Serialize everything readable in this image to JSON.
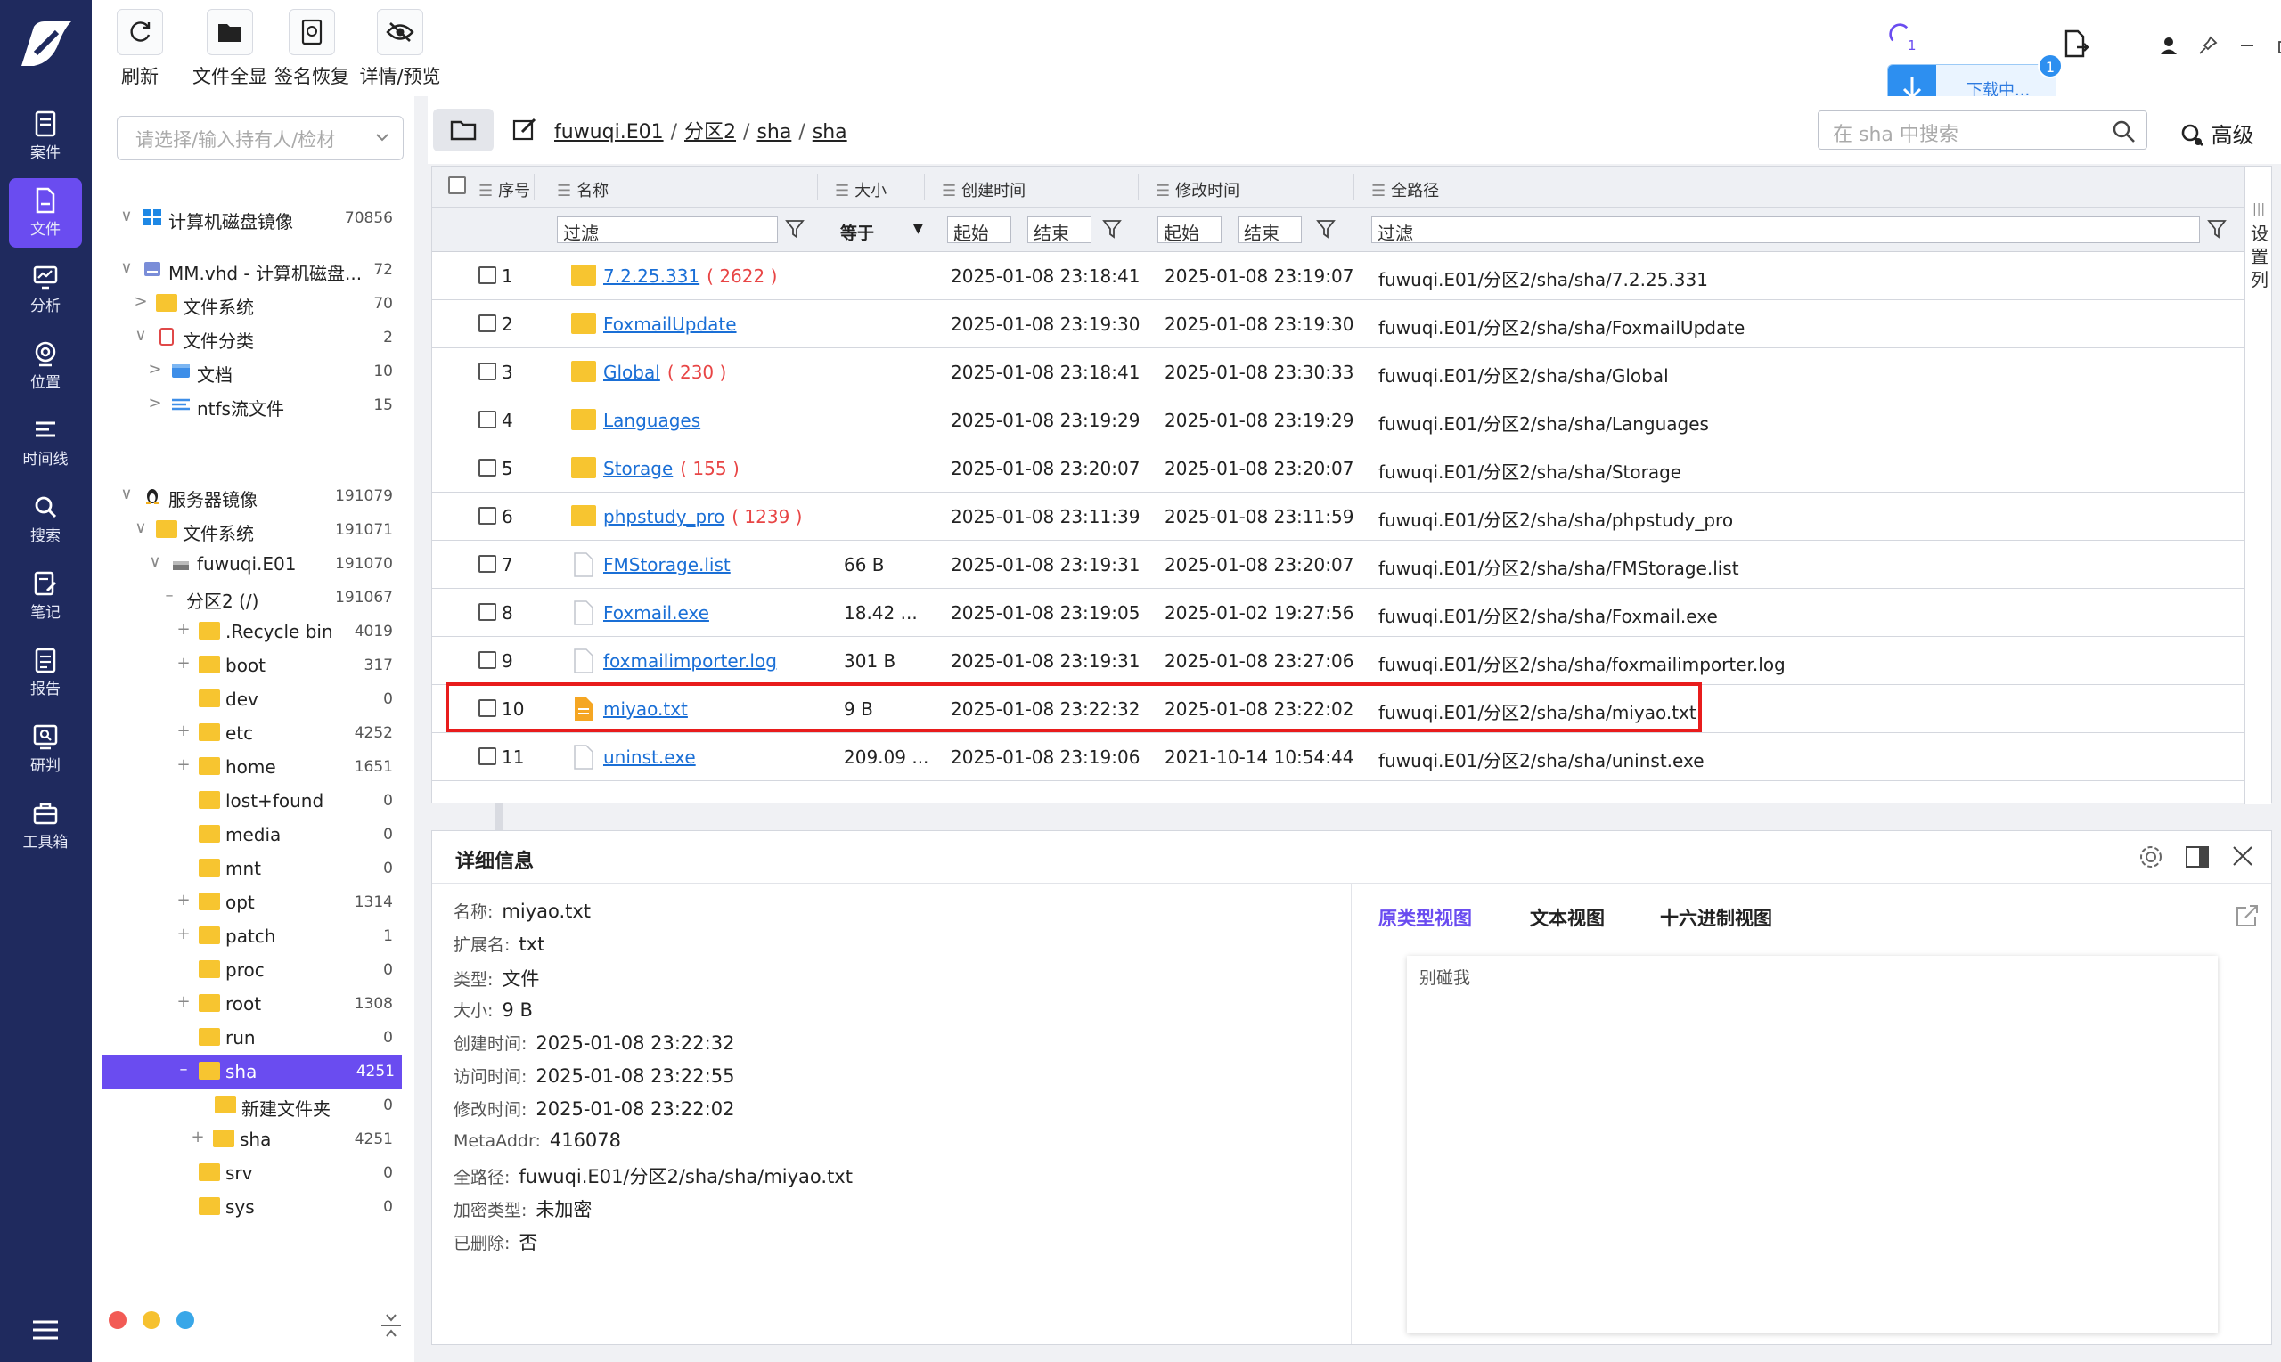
{
  "nav": {
    "items": [
      {
        "id": "case",
        "label": "案件"
      },
      {
        "id": "file",
        "label": "文件"
      },
      {
        "id": "analysis",
        "label": "分析"
      },
      {
        "id": "location",
        "label": "位置"
      },
      {
        "id": "timeline",
        "label": "时间线"
      },
      {
        "id": "search",
        "label": "搜索"
      },
      {
        "id": "notes",
        "label": "笔记"
      },
      {
        "id": "report",
        "label": "报告"
      },
      {
        "id": "judge",
        "label": "研判"
      },
      {
        "id": "toolbox",
        "label": "工具箱"
      }
    ],
    "active": "file"
  },
  "toolbar": {
    "refresh_label": "刷新",
    "show_all_label": "文件全显",
    "sig_restore_label": "签名恢复",
    "details_preview_label": "详情/预览",
    "progress_text": "1",
    "download_text": "下载中...",
    "download_badge": "1"
  },
  "tree": {
    "search_placeholder": "请选择/输入持有人/检材",
    "nodes": [
      {
        "label": "计算机磁盘镜像",
        "count": "70856"
      },
      {
        "label": "MM.vhd - 计算机磁盘...",
        "count": "72"
      },
      {
        "label": "文件系统",
        "count": "70"
      },
      {
        "label": "文件分类",
        "count": "2"
      },
      {
        "label": "文档",
        "count": "10"
      },
      {
        "label": "ntfs流文件",
        "count": "15"
      },
      {
        "label": "服务器镜像",
        "count": "191079"
      },
      {
        "label": "文件系统",
        "count": "191071"
      },
      {
        "label": "fuwuqi.E01",
        "count": "191070"
      },
      {
        "label": "分区2 (/)",
        "count": "191067"
      },
      {
        "label": ".Recycle bin",
        "count": "4019"
      },
      {
        "label": "boot",
        "count": "317"
      },
      {
        "label": "dev",
        "count": "0"
      },
      {
        "label": "etc",
        "count": "4252"
      },
      {
        "label": "home",
        "count": "1651"
      },
      {
        "label": "lost+found",
        "count": "0"
      },
      {
        "label": "media",
        "count": "0"
      },
      {
        "label": "mnt",
        "count": "0"
      },
      {
        "label": "opt",
        "count": "1314"
      },
      {
        "label": "patch",
        "count": "1"
      },
      {
        "label": "proc",
        "count": "0"
      },
      {
        "label": "root",
        "count": "1308"
      },
      {
        "label": "run",
        "count": "0"
      },
      {
        "label": "sha",
        "count": "4251"
      },
      {
        "label": "新建文件夹",
        "count": "0"
      },
      {
        "label": "sha",
        "count": "4251"
      },
      {
        "label": "srv",
        "count": "0"
      },
      {
        "label": "sys",
        "count": "0"
      }
    ]
  },
  "path": {
    "crumbs": [
      "fuwuqi.E01",
      "分区2",
      "sha",
      "sha"
    ],
    "search_placeholder": "在 sha 中搜索",
    "advanced_label": "高级"
  },
  "table": {
    "headers": {
      "index": "序号",
      "name": "名称",
      "size": "大小",
      "created": "创建时间",
      "modified": "修改时间",
      "fullpath": "全路径"
    },
    "filter": {
      "name_placeholder": "过滤",
      "size_op": "等于",
      "start": "起始",
      "end": "结束",
      "path_placeholder": "过滤"
    },
    "column_settings_label": "设置列",
    "rows": [
      {
        "index": "1",
        "name": "7.2.25.331",
        "count": "( 2622 )",
        "size": "",
        "created": "2025-01-08 23:18:41",
        "modified": "2025-01-08 23:19:07",
        "path": "fuwuqi.E01/分区2/sha/sha/7.2.25.331",
        "type": "folder"
      },
      {
        "index": "2",
        "name": "FoxmailUpdate",
        "count": "",
        "size": "",
        "created": "2025-01-08 23:19:30",
        "modified": "2025-01-08 23:19:30",
        "path": "fuwuqi.E01/分区2/sha/sha/FoxmailUpdate",
        "type": "folder"
      },
      {
        "index": "3",
        "name": "Global",
        "count": "( 230 )",
        "size": "",
        "created": "2025-01-08 23:18:41",
        "modified": "2025-01-08 23:30:33",
        "path": "fuwuqi.E01/分区2/sha/sha/Global",
        "type": "folder"
      },
      {
        "index": "4",
        "name": "Languages",
        "count": "",
        "size": "",
        "created": "2025-01-08 23:19:29",
        "modified": "2025-01-08 23:19:29",
        "path": "fuwuqi.E01/分区2/sha/sha/Languages",
        "type": "folder"
      },
      {
        "index": "5",
        "name": "Storage",
        "count": "( 155 )",
        "size": "",
        "created": "2025-01-08 23:20:07",
        "modified": "2025-01-08 23:20:07",
        "path": "fuwuqi.E01/分区2/sha/sha/Storage",
        "type": "folder"
      },
      {
        "index": "6",
        "name": "phpstudy_pro",
        "count": "( 1239 )",
        "size": "",
        "created": "2025-01-08 23:11:39",
        "modified": "2025-01-08 23:11:59",
        "path": "fuwuqi.E01/分区2/sha/sha/phpstudy_pro",
        "type": "folder"
      },
      {
        "index": "7",
        "name": "FMStorage.list",
        "count": "",
        "size": "66 B",
        "created": "2025-01-08 23:19:31",
        "modified": "2025-01-08 23:20:07",
        "path": "fuwuqi.E01/分区2/sha/sha/FMStorage.list",
        "type": "file"
      },
      {
        "index": "8",
        "name": "Foxmail.exe",
        "count": "",
        "size": "18.42 ...",
        "created": "2025-01-08 23:19:05",
        "modified": "2025-01-02 19:27:56",
        "path": "fuwuqi.E01/分区2/sha/sha/Foxmail.exe",
        "type": "file"
      },
      {
        "index": "9",
        "name": "foxmailimporter.log",
        "count": "",
        "size": "301 B",
        "created": "2025-01-08 23:19:31",
        "modified": "2025-01-08 23:27:06",
        "path": "fuwuqi.E01/分区2/sha/sha/foxmailimporter.log",
        "type": "file"
      },
      {
        "index": "10",
        "name": "miyao.txt",
        "count": "",
        "size": "9 B",
        "created": "2025-01-08 23:22:32",
        "modified": "2025-01-08 23:22:02",
        "path": "fuwuqi.E01/分区2/sha/sha/miyao.txt",
        "type": "txt"
      },
      {
        "index": "11",
        "name": "uninst.exe",
        "count": "",
        "size": "209.09 ...",
        "created": "2025-01-08 23:19:06",
        "modified": "2021-10-14 10:54:44",
        "path": "fuwuqi.E01/分区2/sha/sha/uninst.exe",
        "type": "file"
      }
    ]
  },
  "details": {
    "title": "详细信息",
    "fields": [
      {
        "k": "名称:",
        "v": "miyao.txt"
      },
      {
        "k": "扩展名:",
        "v": "txt"
      },
      {
        "k": "类型:",
        "v": "文件"
      },
      {
        "k": "大小:",
        "v": "9 B"
      },
      {
        "k": "创建时间:",
        "v": "2025-01-08 23:22:32"
      },
      {
        "k": "访问时间:",
        "v": "2025-01-08 23:22:55"
      },
      {
        "k": "修改时间:",
        "v": "2025-01-08 23:22:02"
      },
      {
        "k": "MetaAddr:",
        "v": "416078"
      },
      {
        "k": "全路径:",
        "v": "fuwuqi.E01/分区2/sha/sha/miyao.txt"
      },
      {
        "k": "加密类型:",
        "v": "未加密"
      },
      {
        "k": "已删除:",
        "v": "否"
      }
    ],
    "tabs": [
      "原类型视图",
      "文本视图",
      "十六进制视图"
    ],
    "preview_text": "别碰我"
  },
  "colors": {
    "nav_bg": "#1f2a5e",
    "accent": "#6a4cf0",
    "link": "#1a6fd6",
    "highlight": "#e81c1c",
    "count_red": "#e84545",
    "folder": "#f7c530"
  }
}
